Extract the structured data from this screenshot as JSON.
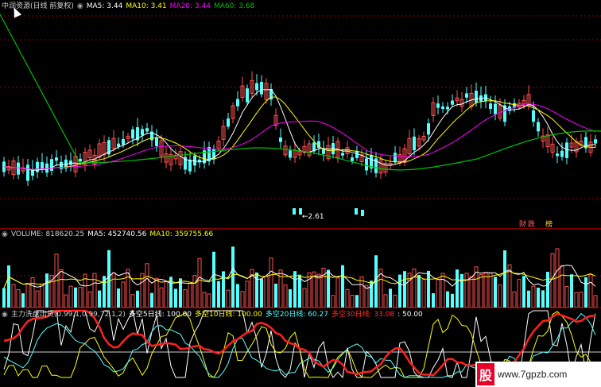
{
  "price_header": {
    "title": "中润资源(日线 前复权)",
    "ma5": "MA5: 3.44",
    "ma10": "MA10: 3.41",
    "ma20": "MA20: 3.44",
    "ma60": "MA60: 3.68",
    "low_label": "←2.61",
    "tag_finance": "财",
    "tag_drop": "跌",
    "tag_rank": "榜"
  },
  "volume_header": {
    "volume": "VOLUME: 818620.25",
    "ma5": "MA5: 452740.56",
    "ma10": "MA10: 359755.66"
  },
  "indicator_header": {
    "name": "主力洗盘出货(0.99,1,0.99,72,1,2)",
    "line5": "多空5日线: 100.00",
    "line10": "多空10日线: 100.00",
    "line20": "多空20日线: 60.27",
    "line30": "多空30日线: 33.08",
    "level": ": 50.00"
  },
  "watermark": {
    "logo_char": "股",
    "url": "www.7gpzb.com"
  },
  "colors": {
    "up": "#ff5050",
    "down": "#54ffff",
    "ma5": "#ffffff",
    "ma10": "#ffff00",
    "ma20": "#ff00ff",
    "ma60": "#00c000",
    "grid": "#8b0000"
  }
}
